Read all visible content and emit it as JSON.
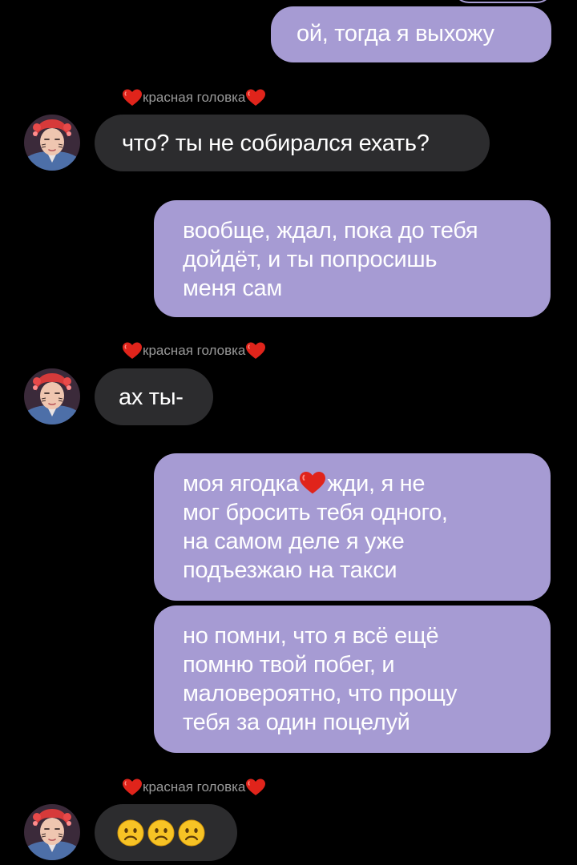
{
  "colors": {
    "background": "#000000",
    "outgoing_bubble": "#a69bd3",
    "incoming_bubble": "#2c2c2e",
    "sender_text": "#9a9a9a",
    "heart": "#e0241b"
  },
  "messages": [
    {
      "direction": "outgoing",
      "text": "ой, тогда я выхожу"
    },
    {
      "direction": "incoming",
      "sender": "красная головка",
      "text": "что? ты не собирался ехать?"
    },
    {
      "direction": "outgoing",
      "lines": [
        "вообще, ждал, пока до тебя",
        "дойдёт, и ты попросишь",
        "меня сам"
      ]
    },
    {
      "direction": "incoming",
      "sender": "красная головка",
      "text": "ах ты-"
    },
    {
      "direction": "outgoing",
      "line1_before_heart": "моя ягодка",
      "line1_after_heart": "жди, я не",
      "lines_rest": [
        "мог бросить тебя одного,",
        "на самом деле я уже",
        "подъезжаю на такси"
      ]
    },
    {
      "direction": "outgoing",
      "lines": [
        "но помни, что я всё ещё",
        "помню твой побег, и",
        "маловероятно, что прощу",
        "тебя за один поцелуй"
      ]
    },
    {
      "direction": "incoming",
      "sender": "красная головка",
      "emojis": [
        "frowning-face-icon",
        "frowning-face-icon",
        "frowning-face-icon"
      ]
    }
  ],
  "sender_decoration": "heart-icon"
}
